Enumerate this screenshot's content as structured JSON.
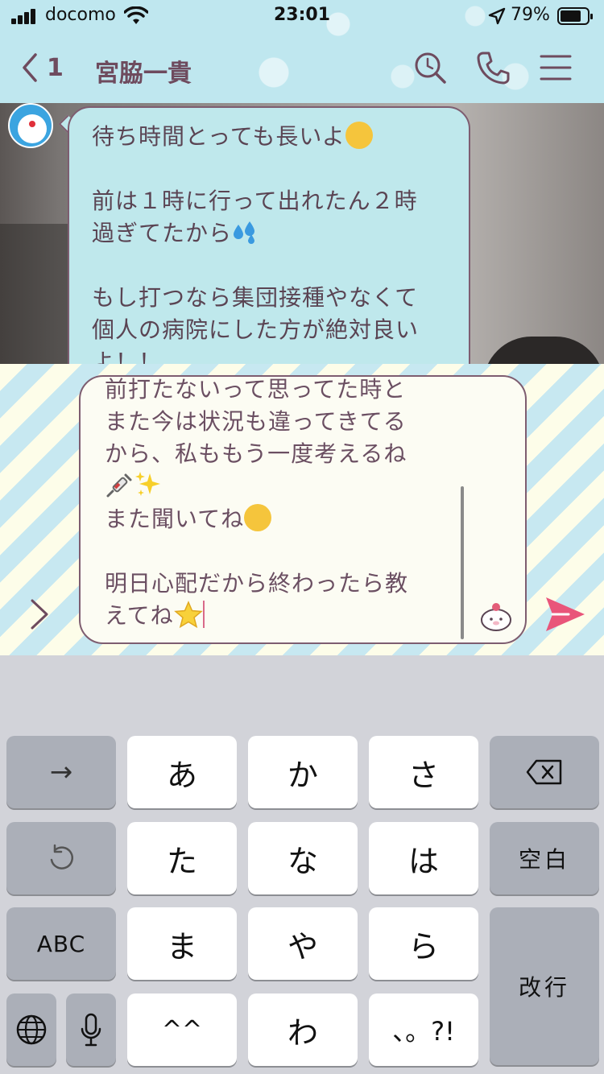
{
  "status_bar": {
    "carrier": "docomo",
    "time": "23:01",
    "battery_percent": "79%",
    "battery_level": 0.79
  },
  "nav": {
    "back_count": "1",
    "title": "宮脇一貴",
    "icons": [
      "back-chevron-icon",
      "search-icon",
      "phone-icon",
      "menu-icon"
    ]
  },
  "message": {
    "paragraphs": [
      "待ち時間とっても長いよ",
      "前は１時に行って出れたん２時\n過ぎてたから",
      "もし打つなら集団接種やなくて\n個人の病院にした方が絶対良い\nよ！！"
    ]
  },
  "compose": {
    "lines": [
      "前打たないって思ってた時と",
      "また今は状況も違ってきてる",
      "から、私ももう一度考えるね",
      "",
      "また聞いてね",
      "",
      "明日心配だから終わったら教",
      "えてね"
    ]
  },
  "keyboard": {
    "rows": [
      [
        "→",
        "あ",
        "か",
        "さ",
        "⌫"
      ],
      [
        "↺",
        "た",
        "な",
        "は",
        "空白"
      ],
      [
        "ABC",
        "ま",
        "や",
        "ら",
        "改行"
      ],
      [
        "🌐",
        "🎤",
        "^^",
        "わ",
        "、。?!"
      ]
    ],
    "space_label": "空白",
    "return_label": "改行",
    "abc_label": "ABC"
  },
  "colors": {
    "header_bg": "#bfe7ef",
    "bubble_bg": "#bfe8ec",
    "bubble_border": "#7e5d70",
    "text": "#5a4453",
    "send_accent": "#e9557a"
  }
}
